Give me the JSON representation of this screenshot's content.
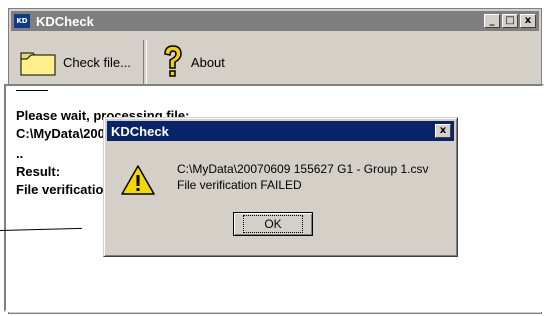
{
  "window": {
    "title": "KDCheck",
    "icon_text": "KD"
  },
  "caption_buttons": {
    "minimize": "_",
    "maximize": "□",
    "close": "x"
  },
  "toolbar": {
    "check_file_label": "Check file...",
    "about_label": "About"
  },
  "output": {
    "line1": "Please wait, processing file:",
    "line2": "C:\\MyData\\20070609 155627 G1 - Group 1.csv",
    "line3": "..",
    "line4": "Result:",
    "line5": "File verification FAILED"
  },
  "dialog": {
    "title": "KDCheck",
    "close": "x",
    "message_line1": "C:\\MyData\\20070609 155627 G1 - Group 1.csv",
    "message_line2": "File verification FAILED",
    "ok_label": "OK"
  }
}
